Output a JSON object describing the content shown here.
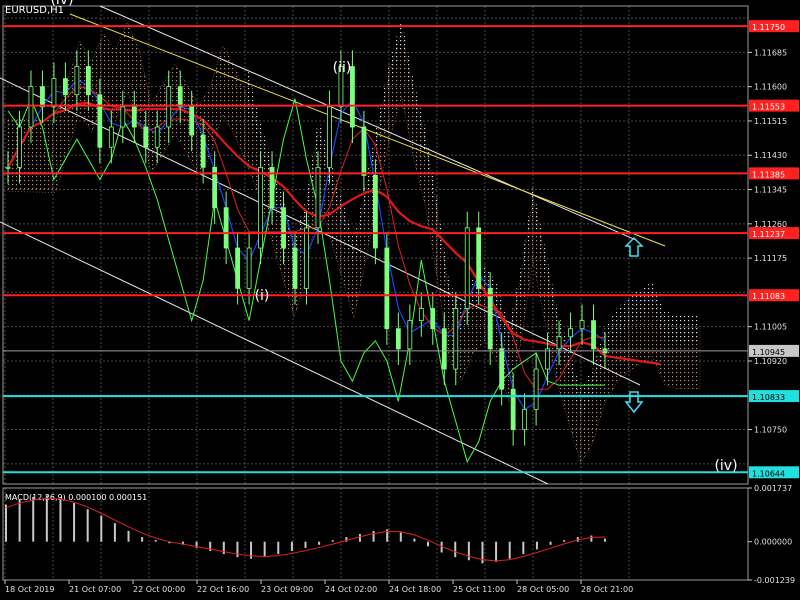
{
  "chart_data": {
    "type": "candlestick",
    "symbol_label": "EURUSD,H1",
    "ylim": [
      1.10615,
      1.118
    ],
    "price_ticks": [
      "1.11770",
      "1.11685",
      "1.11600",
      "1.11515",
      "1.11430",
      "1.11345",
      "1.11260",
      "1.11175",
      "1.11090",
      "1.11005",
      "1.10920",
      "1.10835",
      "1.10750",
      "1.10665"
    ],
    "x_labels": [
      "18 Oct 2019",
      "21 Oct 07:00",
      "22 Oct 00:00",
      "22 Oct 16:00",
      "23 Oct 09:00",
      "24 Oct 02:00",
      "24 Oct 18:00",
      "25 Oct 11:00",
      "28 Oct 05:00",
      "28 Oct 21:00"
    ],
    "current_price": "1.10945",
    "levels": [
      {
        "price": 1.1175,
        "label": "1.11750",
        "color": "#ff2020"
      },
      {
        "price": 1.11553,
        "label": "1.11553",
        "color": "#ff2020"
      },
      {
        "price": 1.11385,
        "label": "1.11385",
        "color": "#ff2020"
      },
      {
        "price": 1.11237,
        "label": "1.11237",
        "color": "#ff2020"
      },
      {
        "price": 1.11083,
        "label": "1.11083",
        "color": "#ff2020"
      },
      {
        "price": 1.10833,
        "label": "1.10833",
        "color": "#20e0e0"
      },
      {
        "price": 1.10644,
        "label": "1.10644",
        "color": "#20e0e0"
      }
    ],
    "wave_labels": [
      "(iv)",
      "(ii)",
      "(i)",
      "(iv)"
    ],
    "macd": {
      "label": "MACD(12,26,9) 0.000100 0.000151",
      "ticks": [
        "0.001737",
        "0.000000",
        "-0.001239"
      ],
      "ylim": [
        -0.001239,
        0.001737
      ],
      "histogram": [
        0.0012,
        0.00135,
        0.00145,
        0.0015,
        0.0014,
        0.00125,
        0.00105,
        0.00085,
        0.0006,
        0.00035,
        0.00015,
        5e-05,
        -5e-05,
        -0.0001,
        -0.0002,
        -0.0003,
        -0.0004,
        -0.0005,
        -0.00055,
        -0.0005,
        -0.0004,
        -0.0003,
        -0.0002,
        -0.0001,
        5e-05,
        0.00015,
        0.00025,
        0.00035,
        0.0004,
        0.0003,
        0.0001,
        -0.00015,
        -0.00035,
        -0.0005,
        -0.0006,
        -0.0007,
        -0.00065,
        -0.00055,
        -0.0004,
        -0.00025,
        -0.0001,
        5e-05,
        0.00015,
        0.0002,
        0.0001
      ],
      "signal": [
        0.0011,
        0.00125,
        0.00135,
        0.0014,
        0.00138,
        0.00128,
        0.00112,
        0.00092,
        0.0007,
        0.00048,
        0.00028,
        0.00012,
        0.0,
        -8e-05,
        -0.00016,
        -0.00024,
        -0.00032,
        -0.0004,
        -0.00046,
        -0.00048,
        -0.00045,
        -0.00038,
        -0.00029,
        -0.00019,
        -8e-05,
        4e-05,
        0.00016,
        0.00026,
        0.00033,
        0.00032,
        0.00022,
        5e-05,
        -0.00015,
        -0.00033,
        -0.00047,
        -0.00058,
        -0.00062,
        -0.00058,
        -0.00048,
        -0.00035,
        -0.00021,
        -7e-05,
        6e-05,
        0.00014,
        0.00015
      ]
    },
    "close": [
      1.114,
      1.115,
      1.116,
      1.1155,
      1.1162,
      1.1158,
      1.1165,
      1.1158,
      1.1145,
      1.115,
      1.1155,
      1.115,
      1.1145,
      1.115,
      1.116,
      1.1155,
      1.1148,
      1.114,
      1.113,
      1.112,
      1.111,
      1.112,
      1.114,
      1.113,
      1.112,
      1.111,
      1.1125,
      1.114,
      1.1155,
      1.1165,
      1.115,
      1.1138,
      1.112,
      1.11,
      1.1095,
      1.1102,
      1.1105,
      1.11,
      1.109,
      1.1105,
      1.1125,
      1.111,
      1.1095,
      1.1085,
      1.1075,
      1.108,
      1.109,
      1.1095,
      1.1098,
      1.11,
      1.1102,
      1.1095,
      1.1094
    ]
  }
}
